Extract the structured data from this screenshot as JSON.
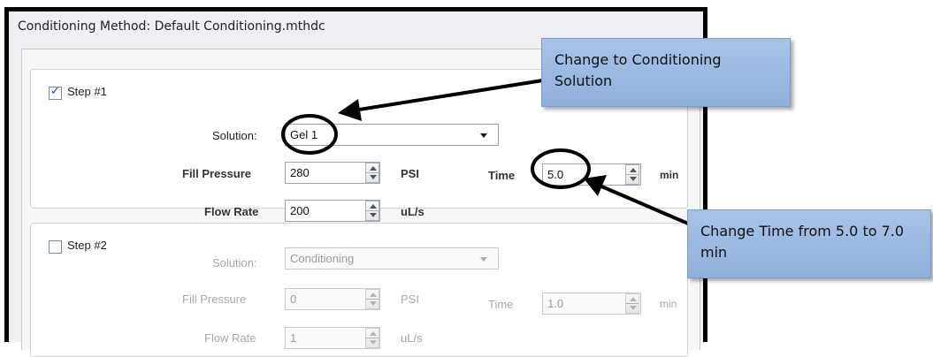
{
  "window": {
    "title": "Conditioning Method: Default Conditioning.mthdc"
  },
  "step1": {
    "label": "Step #1",
    "checked": true,
    "solution_label": "Solution:",
    "solution_value": "Gel 1",
    "fill_pressure_label": "Fill Pressure",
    "fill_pressure_value": "280",
    "fill_pressure_unit": "PSI",
    "time_label": "Time",
    "time_value": "5.0",
    "time_unit": "min",
    "flow_rate_label": "Flow Rate",
    "flow_rate_value": "200",
    "flow_rate_unit": "uL/s"
  },
  "step2": {
    "label": "Step #2",
    "checked": false,
    "solution_label": "Solution:",
    "solution_value": "Conditioning",
    "fill_pressure_label": "Fill Pressure",
    "fill_pressure_value": "0",
    "fill_pressure_unit": "PSI",
    "time_label": "Time",
    "time_value": "1.0",
    "time_unit": "min",
    "flow_rate_label": "Flow Rate",
    "flow_rate_value": "1",
    "flow_rate_unit": "uL/s"
  },
  "annotations": {
    "callout_solution": "Change to Conditioning Solution",
    "callout_time": "Change Time from 5.0 to 7.0 min"
  },
  "colors": {
    "callout_fill": "#99b6e0",
    "frame_border": "#000000",
    "disabled_text": "#a8a8a8"
  }
}
